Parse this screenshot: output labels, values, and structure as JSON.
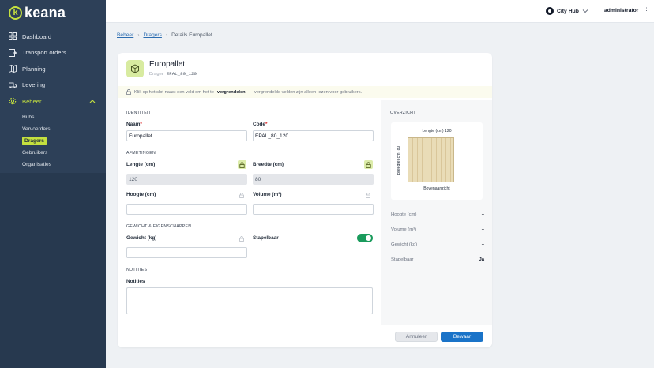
{
  "app": {
    "logo_text": "keana",
    "logo_mark": "k"
  },
  "sidebar": {
    "items": [
      {
        "label": "Dashboard",
        "icon": "grid-icon"
      },
      {
        "label": "Transport orders",
        "icon": "exit-icon"
      },
      {
        "label": "Planning",
        "icon": "map-icon"
      },
      {
        "label": "Levering",
        "icon": "truck-icon"
      },
      {
        "label": "Beheer",
        "icon": "gear-icon",
        "active": true
      }
    ],
    "subitems": [
      {
        "label": "Hubs"
      },
      {
        "label": "Vervoerders"
      },
      {
        "label": "Dragers",
        "active": true
      },
      {
        "label": "Gebruikers"
      },
      {
        "label": "Organisaties"
      }
    ]
  },
  "topbar": {
    "hub_label": "City Hub",
    "user_label": "administrator"
  },
  "breadcrumb": {
    "beheer": "Beheer",
    "dragers": "Dragers",
    "current": "Details Europallet"
  },
  "header": {
    "title": "Europallet",
    "subtitle_label": "Drager",
    "subtitle_code": "EPAL_80_120"
  },
  "notice": {
    "before": "Klik op het slot naast een veld om het te",
    "bold": "vergrendelen",
    "after": "— vergrendelde velden zijn alleen-lezen voor gebruikers."
  },
  "form": {
    "identiteit": "IDENTITEIT",
    "naam_label": "Naam",
    "naam_value": "Europallet",
    "code_label": "Code",
    "code_value": "EPAL_80_120",
    "afmetingen": "AFMETINGEN",
    "lengte_label": "Lengte (cm)",
    "lengte_value": "120",
    "breedte_label": "Breedte (cm)",
    "breedte_value": "80",
    "hoogte_label": "Hoogte (cm)",
    "volume_label": "Volume (m³)",
    "gewicht_section": "GEWICHT & EIGENSCHAPPEN",
    "gewicht_label": "Gewicht (kg)",
    "stapelbaar_label": "Stapelbaar",
    "stapelbaar_on": true,
    "notities_section": "NOTITIES",
    "notities_label": "Notities",
    "required_mark": "*"
  },
  "overview": {
    "title": "OVERZICHT",
    "length_caption": "Lengte (cm) 120",
    "width_caption": "Breedte (cm) 80",
    "view_caption": "Bovenaanzicht",
    "rows": [
      {
        "label": "Hoogte (cm)",
        "value": "–"
      },
      {
        "label": "Volume (m³)",
        "value": "–"
      },
      {
        "label": "Gewicht (kg)",
        "value": "–"
      },
      {
        "label": "Stapelbaar",
        "value": "Ja"
      }
    ]
  },
  "actions": {
    "cancel": "Annuleer",
    "save": "Bewaar"
  },
  "colors": {
    "sidebar": "#27394f",
    "accent": "#c4e03f",
    "primary": "#1a73c8",
    "toggle": "#1a9b5c"
  }
}
